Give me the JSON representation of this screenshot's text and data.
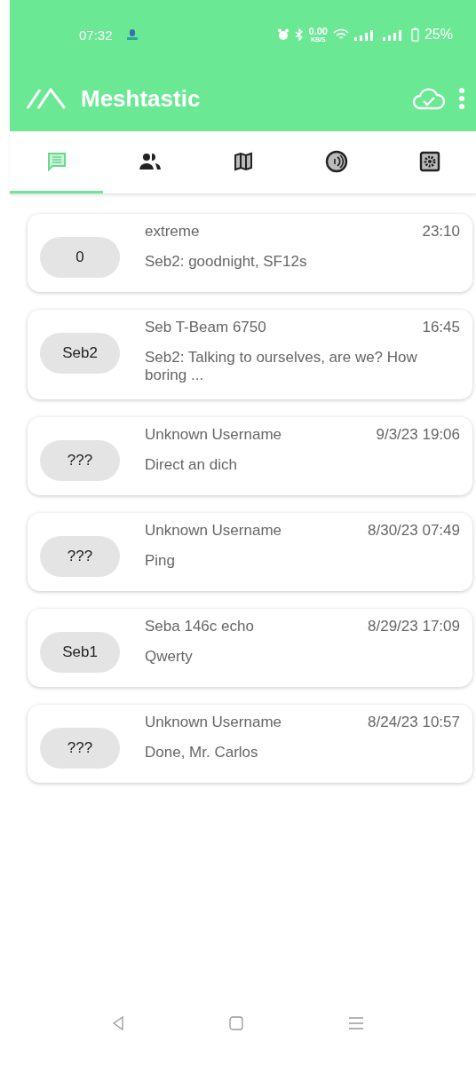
{
  "status_bar": {
    "time": "07:32",
    "net_speed": "0.00",
    "net_unit": "KB/S",
    "battery": "25%"
  },
  "app_bar": {
    "title": "Meshtastic"
  },
  "tabs": [
    {
      "kind": "messages",
      "selected": true
    },
    {
      "kind": "nodes",
      "selected": false
    },
    {
      "kind": "map",
      "selected": false
    },
    {
      "kind": "channel",
      "selected": false
    },
    {
      "kind": "settings",
      "selected": false
    }
  ],
  "conversations": [
    {
      "badge": "0",
      "name": "extreme",
      "time": "23:10",
      "message": "Seb2: goodnight, SF12s"
    },
    {
      "badge": "Seb2",
      "name": "Seb T-Beam 6750",
      "time": "16:45",
      "message": "Seb2: Talking to ourselves, are we? How boring ..."
    },
    {
      "badge": "???",
      "name": "Unknown Username",
      "time": "9/3/23 19:06",
      "message": "Direct an dich"
    },
    {
      "badge": "???",
      "name": "Unknown Username",
      "time": "8/30/23 07:49",
      "message": "Ping"
    },
    {
      "badge": "Seb1",
      "name": "Seba 146c echo",
      "time": "8/29/23 17:09",
      "message": "Qwerty"
    },
    {
      "badge": "???",
      "name": "Unknown Username",
      "time": "8/24/23 10:57",
      "message": "Done, Mr. Carlos"
    }
  ]
}
